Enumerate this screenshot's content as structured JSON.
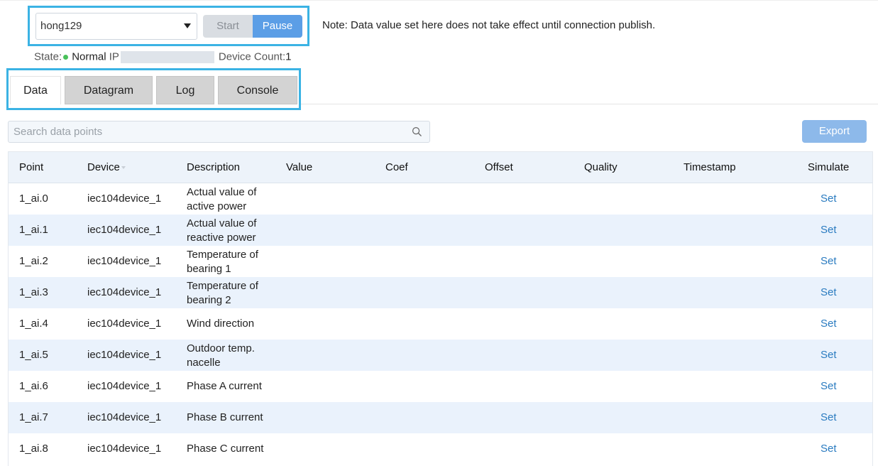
{
  "controls": {
    "connection": "hong129",
    "start_label": "Start",
    "pause_label": "Pause",
    "note": "Note: Data value set here does not take effect until connection publish."
  },
  "status": {
    "state_label": "State:",
    "state_value": "Normal",
    "ip_label": "IP",
    "device_count_label": "Device Count:",
    "device_count_value": "1"
  },
  "tabs": [
    {
      "label": "Data",
      "active": true
    },
    {
      "label": "Datagram",
      "active": false
    },
    {
      "label": "Log",
      "active": false
    },
    {
      "label": "Console",
      "active": false
    }
  ],
  "search": {
    "placeholder": "Search data points"
  },
  "export_label": "Export",
  "table": {
    "headers": [
      "Point",
      "Device",
      "Description",
      "Value",
      "Coef",
      "Offset",
      "Quality",
      "Timestamp",
      "Simulate"
    ],
    "rows": [
      {
        "point": "1_ai.0",
        "device": "iec104device_1",
        "description": "Actual value of active power",
        "action": "Set"
      },
      {
        "point": "1_ai.1",
        "device": "iec104device_1",
        "description": "Actual value of reactive power",
        "action": "Set"
      },
      {
        "point": "1_ai.2",
        "device": "iec104device_1",
        "description": "Temperature of bearing 1",
        "action": "Set"
      },
      {
        "point": "1_ai.3",
        "device": "iec104device_1",
        "description": "Temperature of bearing 2",
        "action": "Set"
      },
      {
        "point": "1_ai.4",
        "device": "iec104device_1",
        "description": "Wind direction",
        "action": "Set"
      },
      {
        "point": "1_ai.5",
        "device": "iec104device_1",
        "description": "Outdoor temp. nacelle",
        "action": "Set"
      },
      {
        "point": "1_ai.6",
        "device": "iec104device_1",
        "description": "Phase A current",
        "action": "Set"
      },
      {
        "point": "1_ai.7",
        "device": "iec104device_1",
        "description": "Phase B current",
        "action": "Set"
      },
      {
        "point": "1_ai.8",
        "device": "iec104device_1",
        "description": "Phase C current",
        "action": "Set"
      }
    ]
  },
  "colors": {
    "highlight_border": "#3bb3e4",
    "primary": "#5b9ee6",
    "link": "#2a7bc0",
    "status_ok": "#49c15a"
  }
}
